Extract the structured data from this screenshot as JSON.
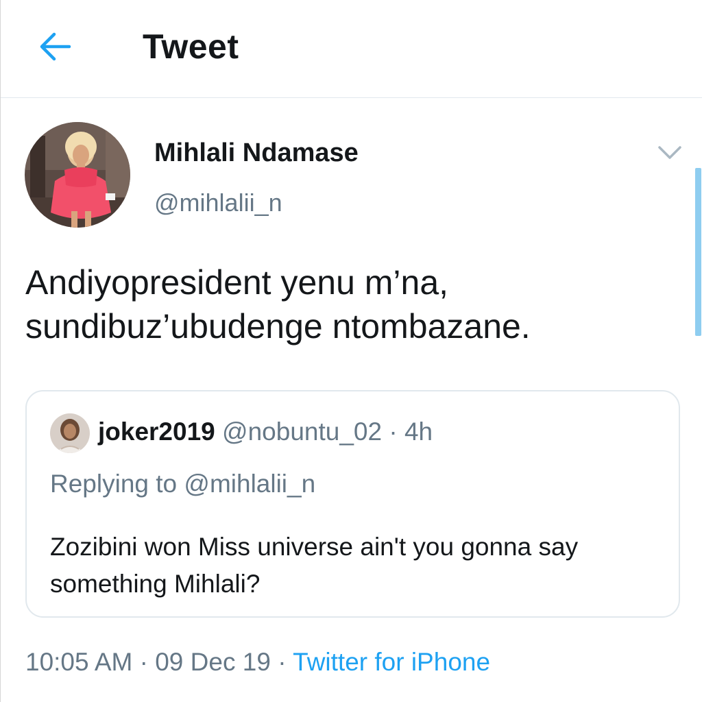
{
  "header": {
    "title": "Tweet",
    "back_icon": "arrow-left-icon",
    "accent_color": "#1da1f2"
  },
  "tweet": {
    "author_name": "Mihlali Ndamase",
    "author_handle": "@mihlalii_n",
    "menu_icon": "chevron-down-icon",
    "text_line1": "Andiyopresident yenu m’na,",
    "text_line2": "sundibuz’ubudenge ntombazane."
  },
  "quoted": {
    "name": "joker2019",
    "handle": "@nobuntu_02",
    "separator": "·",
    "time": "4h",
    "replying_to": "Replying to @mihlalii_n",
    "text": "Zozibini won Miss universe ain't you gonna say something Mihlali?"
  },
  "meta": {
    "time": "10:05 AM",
    "separator1": "·",
    "date": "09 Dec 19",
    "separator2": "·",
    "source": "Twitter for iPhone"
  },
  "colors": {
    "text_primary": "#14171a",
    "text_secondary": "#657786",
    "link": "#1da1f2",
    "border": "#e1e8ed"
  }
}
